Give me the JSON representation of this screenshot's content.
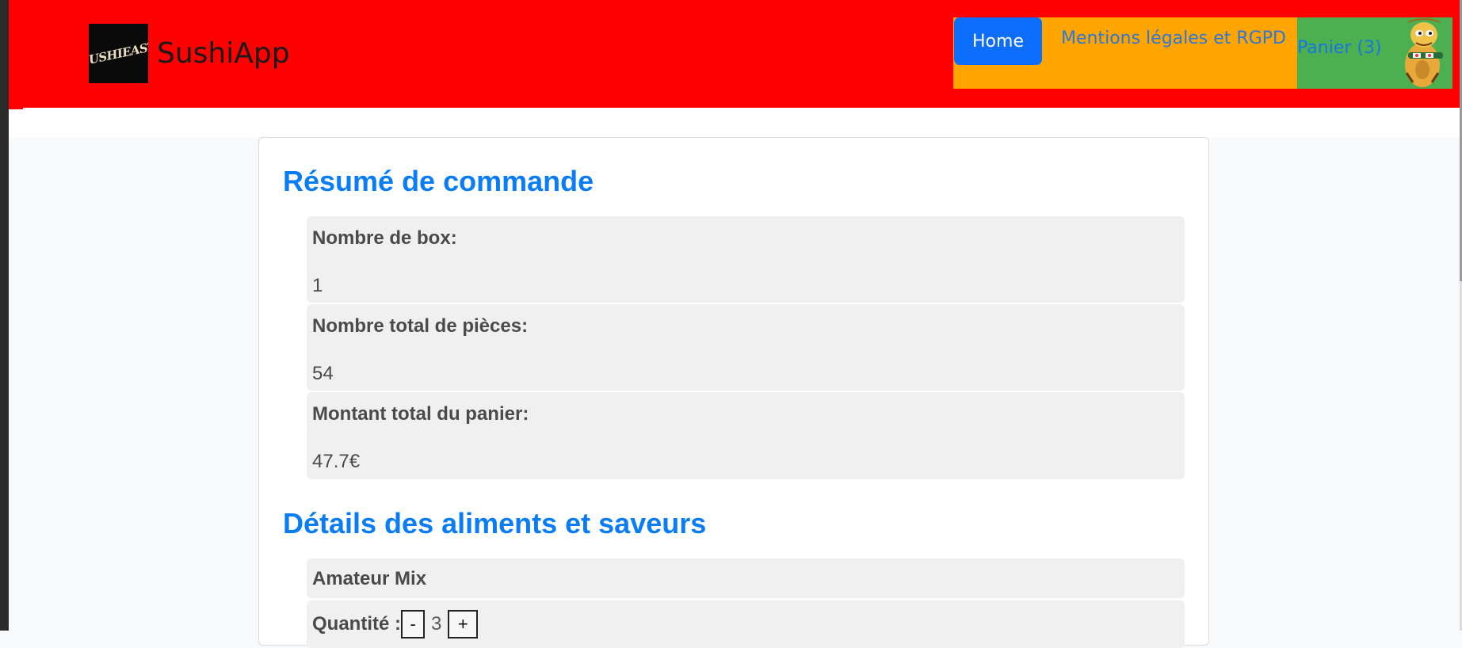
{
  "app": {
    "brand_name": "SushiApp",
    "logo_text": "SUSHIEAST"
  },
  "nav": {
    "home_label": "Home",
    "legal_label": "Mentions légales et RGPD",
    "cart_label": "Panier (3)"
  },
  "colors": {
    "navbar": "#ff0000",
    "nav_orange": "#ffa500",
    "nav_green": "#4caf50",
    "primary": "#0d6efd",
    "title_blue": "#0a7cf6"
  },
  "summary": {
    "title": "Résumé de commande",
    "box_count_label": "Nombre de box:",
    "box_count_value": "1",
    "pieces_label": "Nombre total de pièces:",
    "pieces_value": "54",
    "total_label": "Montant total du panier:",
    "total_value": "47.7€"
  },
  "details": {
    "title": "Détails des aliments et saveurs",
    "item_name": "Amateur Mix",
    "quantity_label": "Quantité :",
    "minus_label": "-",
    "quantity_value": "3",
    "plus_label": "+"
  }
}
